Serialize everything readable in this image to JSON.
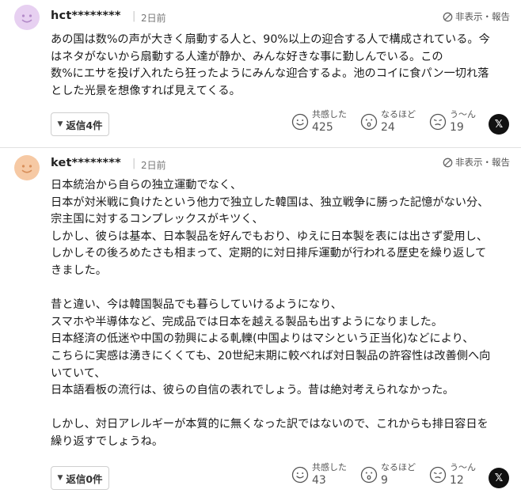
{
  "comments": [
    {
      "username": "hct********",
      "date": "2日前",
      "report_label": "非表示・報告",
      "avatar_color": "#e7d0f1",
      "lines": [
        "あの国は数%の声が大きく扇動する人と、90%以上の迎合する人で構成されている。今",
        "はネタがないから扇動する人達が静か、みんな好きな事に勤しんでいる。この",
        "数%にエサを投げ入れたら狂ったようにみんな迎合するよ。池のコイに食パン一切れ落",
        "とした光景を想像すれば見えてくる。"
      ],
      "reply_label": "返信4件",
      "reactions": [
        {
          "label": "共感した",
          "count": "425",
          "icon": "smile-face-icon"
        },
        {
          "label": "なるほど",
          "count": "24",
          "icon": "surprised-face-icon"
        },
        {
          "label": "う〜ん",
          "count": "19",
          "icon": "thinking-face-icon"
        }
      ],
      "share_label": "𝕏"
    },
    {
      "username": "ket********",
      "date": "2日前",
      "report_label": "非表示・報告",
      "avatar_color": "#f6c9a4",
      "lines": [
        "日本統治から自らの独立運動でなく、",
        "日本が対米戦に負けたという他力で独立した韓国は、独立戦争に勝った記憶がない分、",
        "宗主国に対するコンプレックスがキツく、",
        "しかし、彼らは基本、日本製品を好んでもおり、ゆえに日本製を表には出さず愛用し、",
        "しかしその後ろめたさも相まって、定期的に対日排斥運動が行われる歴史を繰り返して",
        "きました。",
        "",
        "昔と違い、今は韓国製品でも暮らしていけるようになり、",
        "スマホや半導体など、完成品では日本を越える製品も出すようになりました。",
        "日本経済の低迷や中国の勃興による軋轢(中国よりはマシという正当化)などにより、",
        "こちらに実感は湧きにくくても、20世紀末期に較べれば対日製品の許容性は改善側へ向",
        "いていて、",
        "日本語看板の流行は、彼らの自信の表れでしょう。昔は絶対考えられなかった。",
        "",
        "しかし、対日アレルギーが本質的に無くなった訳ではないので、これからも排日容日を",
        "繰り返すでしょうね。"
      ],
      "reply_label": "返信0件",
      "reactions": [
        {
          "label": "共感した",
          "count": "43",
          "icon": "smile-face-icon"
        },
        {
          "label": "なるほど",
          "count": "9",
          "icon": "surprised-face-icon"
        },
        {
          "label": "う〜ん",
          "count": "12",
          "icon": "thinking-face-icon"
        }
      ],
      "share_label": "𝕏"
    }
  ]
}
